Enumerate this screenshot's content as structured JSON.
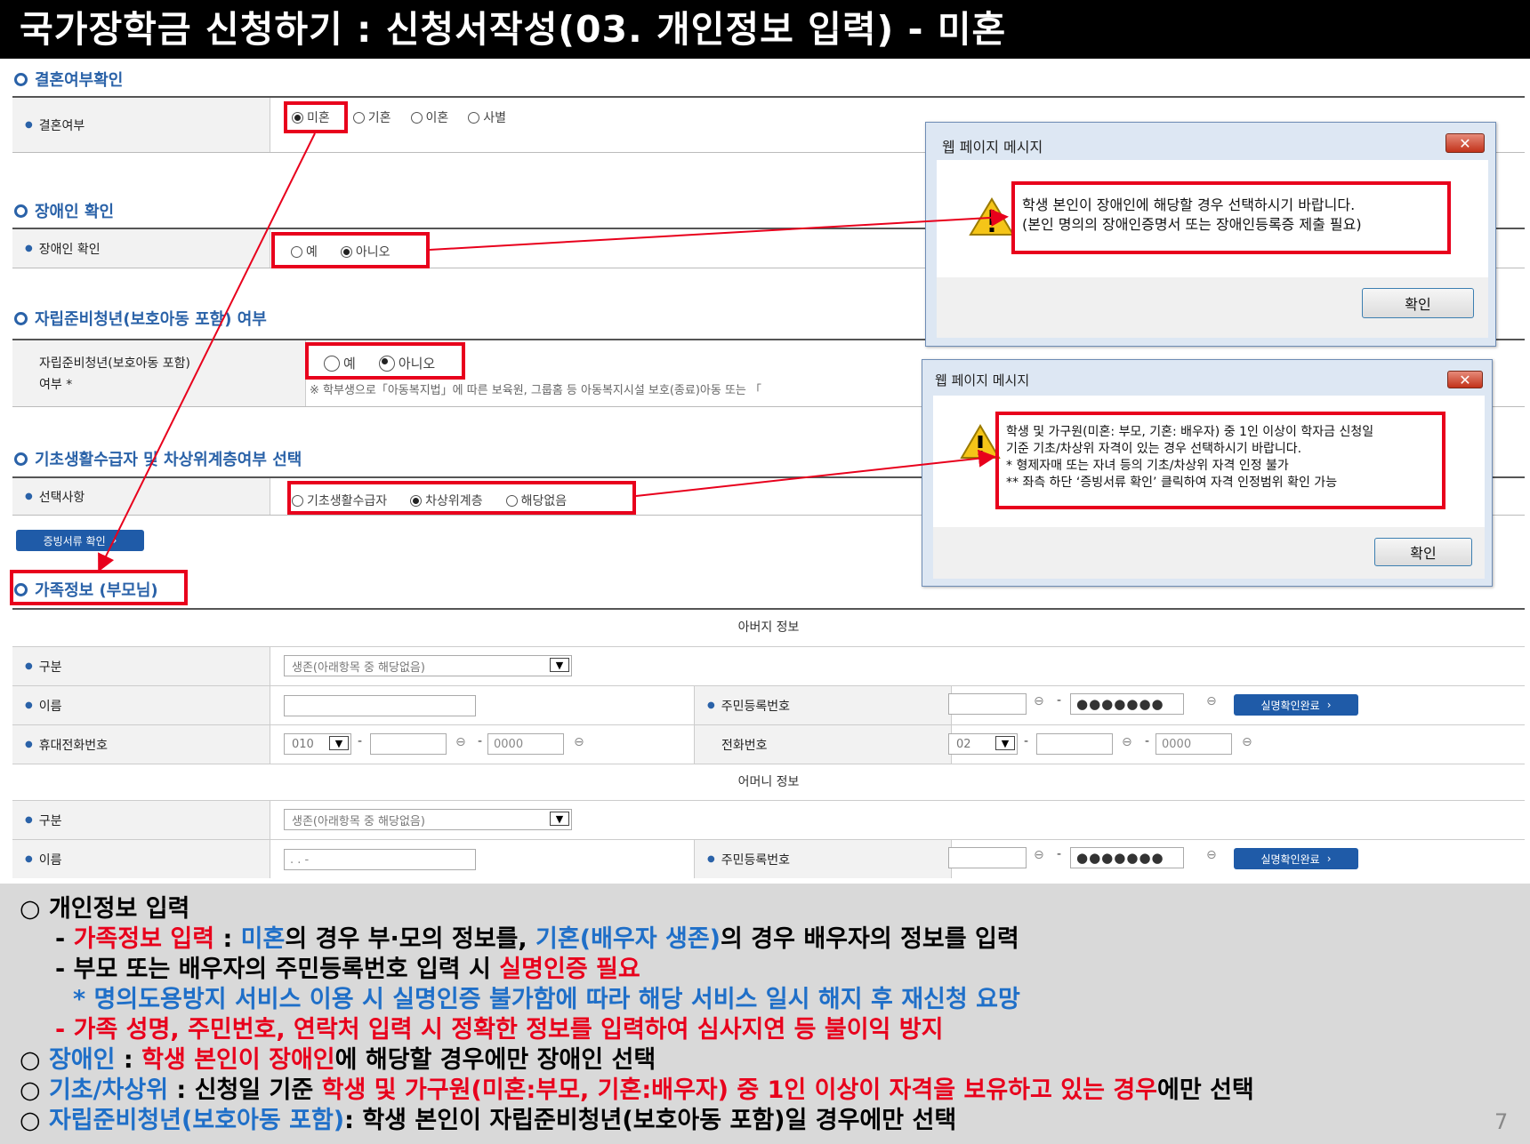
{
  "header": {
    "title": "국가장학금 신청하기 : 신청서작성(03. 개인정보 입력) - 미혼"
  },
  "marriage": {
    "section_title": "결혼여부확인",
    "label": "결혼여부",
    "options": [
      "미혼",
      "기혼",
      "이혼",
      "사별"
    ]
  },
  "disability": {
    "section_title": "장애인 확인",
    "label": "장애인 확인",
    "options": [
      "예",
      "아니오"
    ]
  },
  "youth": {
    "section_title": "자립준비청년(보호아동 포함) 여부",
    "label_line1": "자립준비청년(보호아동 포함)",
    "label_line2": "여부 *",
    "options": [
      "예",
      "아니오"
    ],
    "note": "※ 학부생으로「아동복지법」에 따른 보육원, 그룹홈 등 아동복지시설 보호(종료)아동 또는 「"
  },
  "basic": {
    "section_title": "기초생활수급자 및 차상위계층여부 선택",
    "label": "선택사항",
    "options": [
      "기초생활수급자",
      "차상위계층",
      "해당없음"
    ],
    "doc_button": "증빙서류 확인"
  },
  "family": {
    "section_title": "가족정보 (부모님)",
    "father_header": "아버지 정보",
    "mother_header": "어머니 정보",
    "label_type": "구분",
    "label_name": "이름",
    "label_rrn": "주민등록번호",
    "label_mobile": "휴대전화번호",
    "label_phone": "전화번호",
    "type_value": "생존(아래항목 중 해당없음)",
    "mobile_prefix": "010",
    "phone_prefix": "02",
    "placeholder_number": "0000",
    "rrn_masked": "●●●●●●●",
    "verify_button": "실명확인완료",
    "mother_name_value": ". . -"
  },
  "dialog1": {
    "title": "웹 페이지 메시지",
    "message_line1": "학생 본인이 장애인에 해당할 경우 선택하시기 바랍니다.",
    "message_line2": "(본인 명의의 장애인증명서 또는 장애인등록증 제출 필요)",
    "ok": "확인"
  },
  "dialog2": {
    "title": "웹 페이지 메시지",
    "message_line1": "학생 및 가구원(미혼: 부모, 기혼: 배우자) 중 1인 이상이 학자금 신청일",
    "message_line2": "기준 기초/차상위 자격이 있는 경우 선택하시기 바랍니다.",
    "message_line3": "* 형제자매 또는 자녀 등의 기초/차상위 자격 인정 불가",
    "message_line4": "** 좌측 하단 ‘증빙서류 확인’ 클릭하여 자격 인정범위 확인 가능",
    "ok": "확인"
  },
  "instructions": {
    "l1": "○ 개인정보 입력",
    "l2a": "- ",
    "l2b": "가족정보 입력",
    "l2c": " : ",
    "l2d": "미혼",
    "l2e": "의 경우 부·모의 정보를, ",
    "l2f": "기혼(배우자 생존)",
    "l2g": "의 경우 배우자의 정보를 입력",
    "l3a": "- 부모 또는 배우자의 주민등록번호 입력 시 ",
    "l3b": "실명인증 필요",
    "l4": "* 명의도용방지 서비스 이용 시 실명인증 불가함에 따라 해당 서비스 일시 해지 후 재신청 요망",
    "l5": "- 가족 성명, 주민번호, 연락처 입력 시 정확한 정보를 입력하여 심사지연 등 불이익 방지",
    "l6a": "○ ",
    "l6b": "장애인",
    "l6c": " : ",
    "l6d": "학생 본인이 장애인",
    "l6e": "에 해당할 경우에만 장애인 선택",
    "l7a": "○ ",
    "l7b": "기초/차상위",
    "l7c": " : 신청일 기준 ",
    "l7d": "학생 및 가구원(미혼:부모, 기혼:배우자) 중 1인 이상이 자격을 보유하고 있는 경우",
    "l7e": "에만 선택",
    "l8a": "○ ",
    "l8b": "자립준비청년(보호아동 포함)",
    "l8c": ": 학생 본인이 자립준비청년(보호아동 포함)일 경우에만 선택"
  },
  "page_number": "7",
  "colors": {
    "accent_red": "#e8001c",
    "accent_blue": "#1f6fc8",
    "section_blue": "#2a62a8"
  }
}
